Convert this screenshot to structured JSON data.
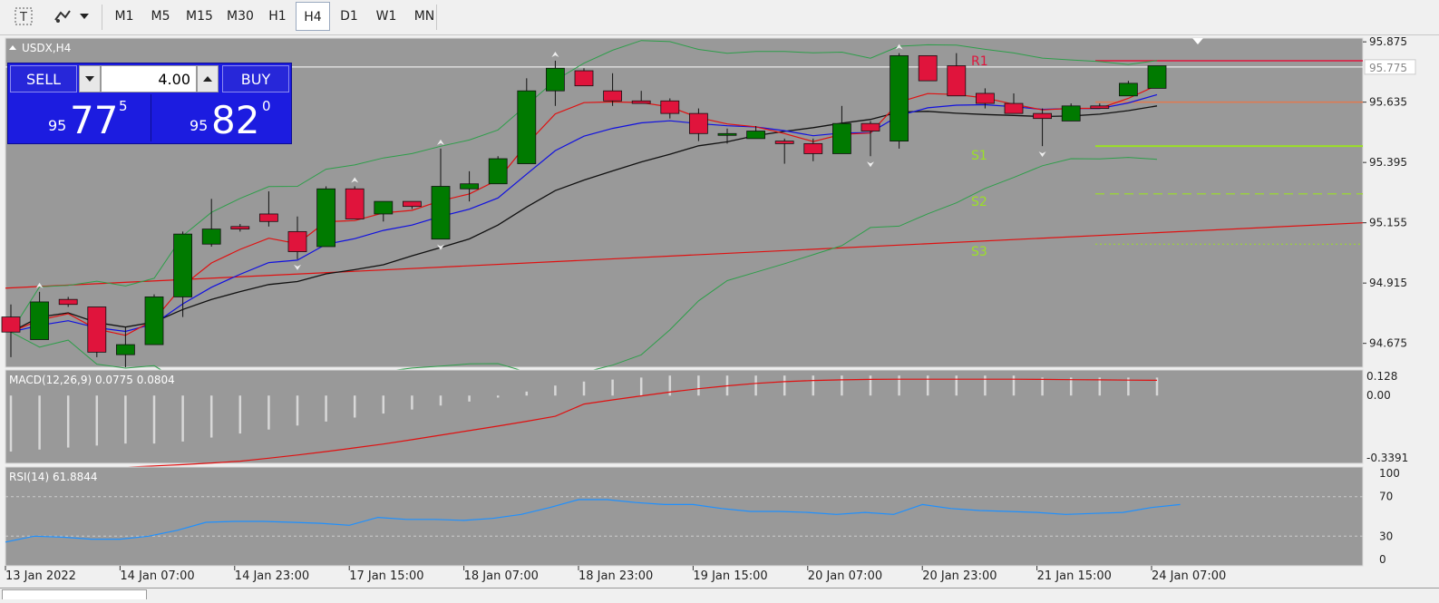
{
  "toolbar": {
    "timeframes": [
      "M1",
      "M5",
      "M15",
      "M30",
      "H1",
      "H4",
      "D1",
      "W1",
      "MN"
    ],
    "active": "H4"
  },
  "chart": {
    "symbol_label": "USDX,H4",
    "current_price": "95.775",
    "price_labels": [
      "95.875",
      "95.635",
      "95.395",
      "95.155",
      "94.915",
      "94.675"
    ],
    "time_labels": [
      "13 Jan 2022",
      "14 Jan 07:00",
      "14 Jan 23:00",
      "17 Jan 15:00",
      "18 Jan 07:00",
      "18 Jan 23:00",
      "19 Jan 15:00",
      "20 Jan 07:00",
      "20 Jan 23:00",
      "21 Jan 15:00",
      "24 Jan 07:00"
    ],
    "pivot_labels": {
      "r1": "R1",
      "s1": "S1",
      "s2": "S2",
      "s3": "S3"
    },
    "colors": {
      "background": "#999999",
      "bull": "#007a00",
      "bear": "#e0143c",
      "ma_blue": "#1010e0",
      "ma_black": "#101010",
      "ma_red": "#e01010",
      "bands": "#2e9e4a",
      "r1": "#e0143c",
      "s1": "#9be026"
    }
  },
  "trade_panel": {
    "sell_label": "SELL",
    "buy_label": "BUY",
    "lot": "4.00",
    "sell_price": {
      "small": "95",
      "big": "77",
      "sup": "5"
    },
    "buy_price": {
      "small": "95",
      "big": "82",
      "sup": "0"
    }
  },
  "macd": {
    "label": "MACD(12,26,9) 0.0775 0.0804",
    "scale": [
      "0.128",
      "0.00",
      "-0.3391"
    ]
  },
  "rsi": {
    "label": "RSI(14) 61.8844",
    "scale": [
      "100",
      "70",
      "30",
      "0"
    ]
  },
  "chart_data": {
    "type": "candlestick",
    "symbol": "USDX",
    "timeframe": "H4",
    "candles": [
      {
        "o": 94.78,
        "h": 94.83,
        "l": 94.62,
        "c": 94.72
      },
      {
        "o": 94.69,
        "h": 94.88,
        "l": 94.69,
        "c": 94.84
      },
      {
        "o": 94.85,
        "h": 94.86,
        "l": 94.82,
        "c": 94.83
      },
      {
        "o": 94.82,
        "h": 94.82,
        "l": 94.62,
        "c": 94.64
      },
      {
        "o": 94.63,
        "h": 94.74,
        "l": 94.58,
        "c": 94.67
      },
      {
        "o": 94.67,
        "h": 94.87,
        "l": 94.67,
        "c": 94.86
      },
      {
        "o": 94.86,
        "h": 95.12,
        "l": 94.78,
        "c": 95.11
      },
      {
        "o": 95.07,
        "h": 95.25,
        "l": 95.06,
        "c": 95.13
      },
      {
        "o": 95.14,
        "h": 95.15,
        "l": 95.12,
        "c": 95.13
      },
      {
        "o": 95.19,
        "h": 95.28,
        "l": 95.14,
        "c": 95.16
      },
      {
        "o": 95.12,
        "h": 95.18,
        "l": 95.01,
        "c": 95.04
      },
      {
        "o": 95.06,
        "h": 95.3,
        "l": 95.06,
        "c": 95.29
      },
      {
        "o": 95.29,
        "h": 95.3,
        "l": 95.18,
        "c": 95.17
      },
      {
        "o": 95.19,
        "h": 95.24,
        "l": 95.16,
        "c": 95.24
      },
      {
        "o": 95.24,
        "h": 95.24,
        "l": 95.21,
        "c": 95.22
      },
      {
        "o": 95.09,
        "h": 95.45,
        "l": 95.09,
        "c": 95.3
      },
      {
        "o": 95.29,
        "h": 95.36,
        "l": 95.24,
        "c": 95.31
      },
      {
        "o": 95.31,
        "h": 95.42,
        "l": 95.31,
        "c": 95.41
      },
      {
        "o": 95.39,
        "h": 95.73,
        "l": 95.39,
        "c": 95.68
      },
      {
        "o": 95.68,
        "h": 95.8,
        "l": 95.62,
        "c": 95.77
      },
      {
        "o": 95.76,
        "h": 95.77,
        "l": 95.7,
        "c": 95.7
      },
      {
        "o": 95.68,
        "h": 95.75,
        "l": 95.62,
        "c": 95.64
      },
      {
        "o": 95.64,
        "h": 95.68,
        "l": 95.63,
        "c": 95.63
      },
      {
        "o": 95.64,
        "h": 95.65,
        "l": 95.57,
        "c": 95.59
      },
      {
        "o": 95.59,
        "h": 95.61,
        "l": 95.48,
        "c": 95.51
      },
      {
        "o": 95.51,
        "h": 95.53,
        "l": 95.47,
        "c": 95.51
      },
      {
        "o": 95.49,
        "h": 95.54,
        "l": 95.49,
        "c": 95.52
      },
      {
        "o": 95.48,
        "h": 95.49,
        "l": 95.39,
        "c": 95.47
      },
      {
        "o": 95.47,
        "h": 95.49,
        "l": 95.4,
        "c": 95.43
      },
      {
        "o": 95.43,
        "h": 95.62,
        "l": 95.43,
        "c": 95.55
      },
      {
        "o": 95.55,
        "h": 95.56,
        "l": 95.42,
        "c": 95.52
      },
      {
        "o": 95.48,
        "h": 95.83,
        "l": 95.45,
        "c": 95.82
      },
      {
        "o": 95.82,
        "h": 95.82,
        "l": 95.72,
        "c": 95.72
      },
      {
        "o": 95.78,
        "h": 95.83,
        "l": 95.66,
        "c": 95.66
      },
      {
        "o": 95.67,
        "h": 95.69,
        "l": 95.61,
        "c": 95.63
      },
      {
        "o": 95.63,
        "h": 95.67,
        "l": 95.59,
        "c": 95.59
      },
      {
        "o": 95.59,
        "h": 95.61,
        "l": 95.46,
        "c": 95.57
      },
      {
        "o": 95.56,
        "h": 95.63,
        "l": 95.56,
        "c": 95.62
      },
      {
        "o": 95.62,
        "h": 95.63,
        "l": 95.61,
        "c": 95.61
      },
      {
        "o": 95.66,
        "h": 95.72,
        "l": 95.66,
        "c": 95.71
      },
      {
        "o": 95.69,
        "h": 95.78,
        "l": 95.69,
        "c": 95.78
      }
    ],
    "pivots": {
      "R1": 95.8,
      "P": 95.635,
      "S1": 95.46,
      "S2": 95.27,
      "S3": 95.07
    },
    "y_range": [
      94.58,
      95.89
    ],
    "macd_histogram": [
      -0.28,
      -0.27,
      -0.26,
      -0.25,
      -0.24,
      -0.24,
      -0.23,
      -0.21,
      -0.19,
      -0.17,
      -0.15,
      -0.13,
      -0.11,
      -0.09,
      -0.07,
      -0.05,
      -0.03,
      -0.01,
      0.02,
      0.05,
      0.07,
      0.08,
      0.09,
      0.1,
      0.1,
      0.1,
      0.1,
      0.1,
      0.1,
      0.1,
      0.1,
      0.1,
      0.1,
      0.1,
      0.1,
      0.1,
      0.09,
      0.09,
      0.09,
      0.09,
      0.09
    ],
    "macd_range": [
      -0.3391,
      0.128
    ],
    "rsi": [
      24,
      30,
      29,
      27,
      27,
      30,
      36,
      44,
      45,
      45,
      44,
      43,
      41,
      49,
      47,
      47,
      46,
      48,
      52,
      59,
      67,
      67,
      64,
      62,
      62,
      58,
      55,
      55,
      54,
      52,
      54,
      52,
      62,
      58,
      56,
      55,
      54,
      52,
      53,
      54,
      59,
      62
    ],
    "rsi_levels": [
      70,
      30
    ]
  }
}
